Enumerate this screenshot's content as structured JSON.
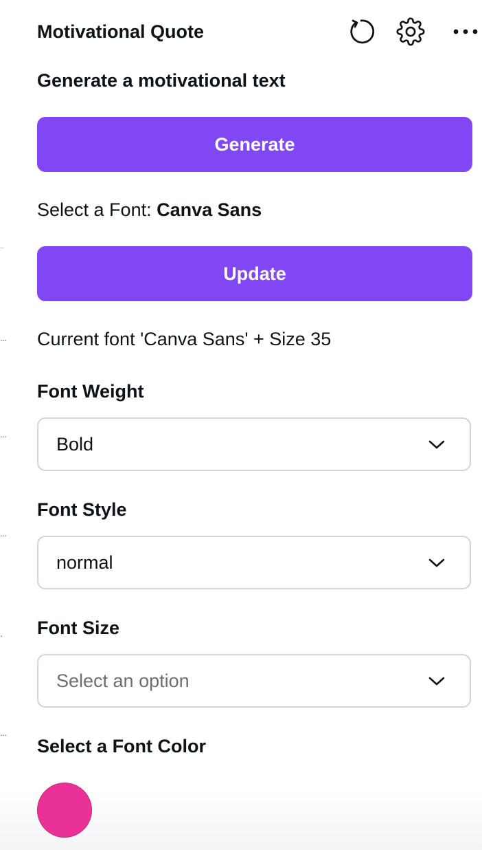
{
  "header": {
    "title": "Motivational Quote",
    "icons": [
      "reload-icon",
      "gear-icon",
      "more-icon"
    ]
  },
  "generate_section": {
    "label": "Generate a motivational text",
    "button_label": "Generate"
  },
  "font_select": {
    "prefix": "Select a Font:",
    "font_name": "Canva Sans",
    "button_label": "Update"
  },
  "current_font": "Current font 'Canva Sans' + Size 35",
  "font_weight": {
    "label": "Font Weight",
    "value": "Bold"
  },
  "font_style": {
    "label": "Font Style",
    "value": "normal"
  },
  "font_size": {
    "label": "Font Size",
    "placeholder": "Select an option"
  },
  "font_color": {
    "label": "Select a Font Color",
    "color": "#ea3197"
  },
  "edge_marks": [
    "...",
    "...",
    "...",
    ".",
    "..."
  ],
  "colors": {
    "accent": "#8247f5",
    "border": "#d2d4d7",
    "text": "#0e1318"
  }
}
